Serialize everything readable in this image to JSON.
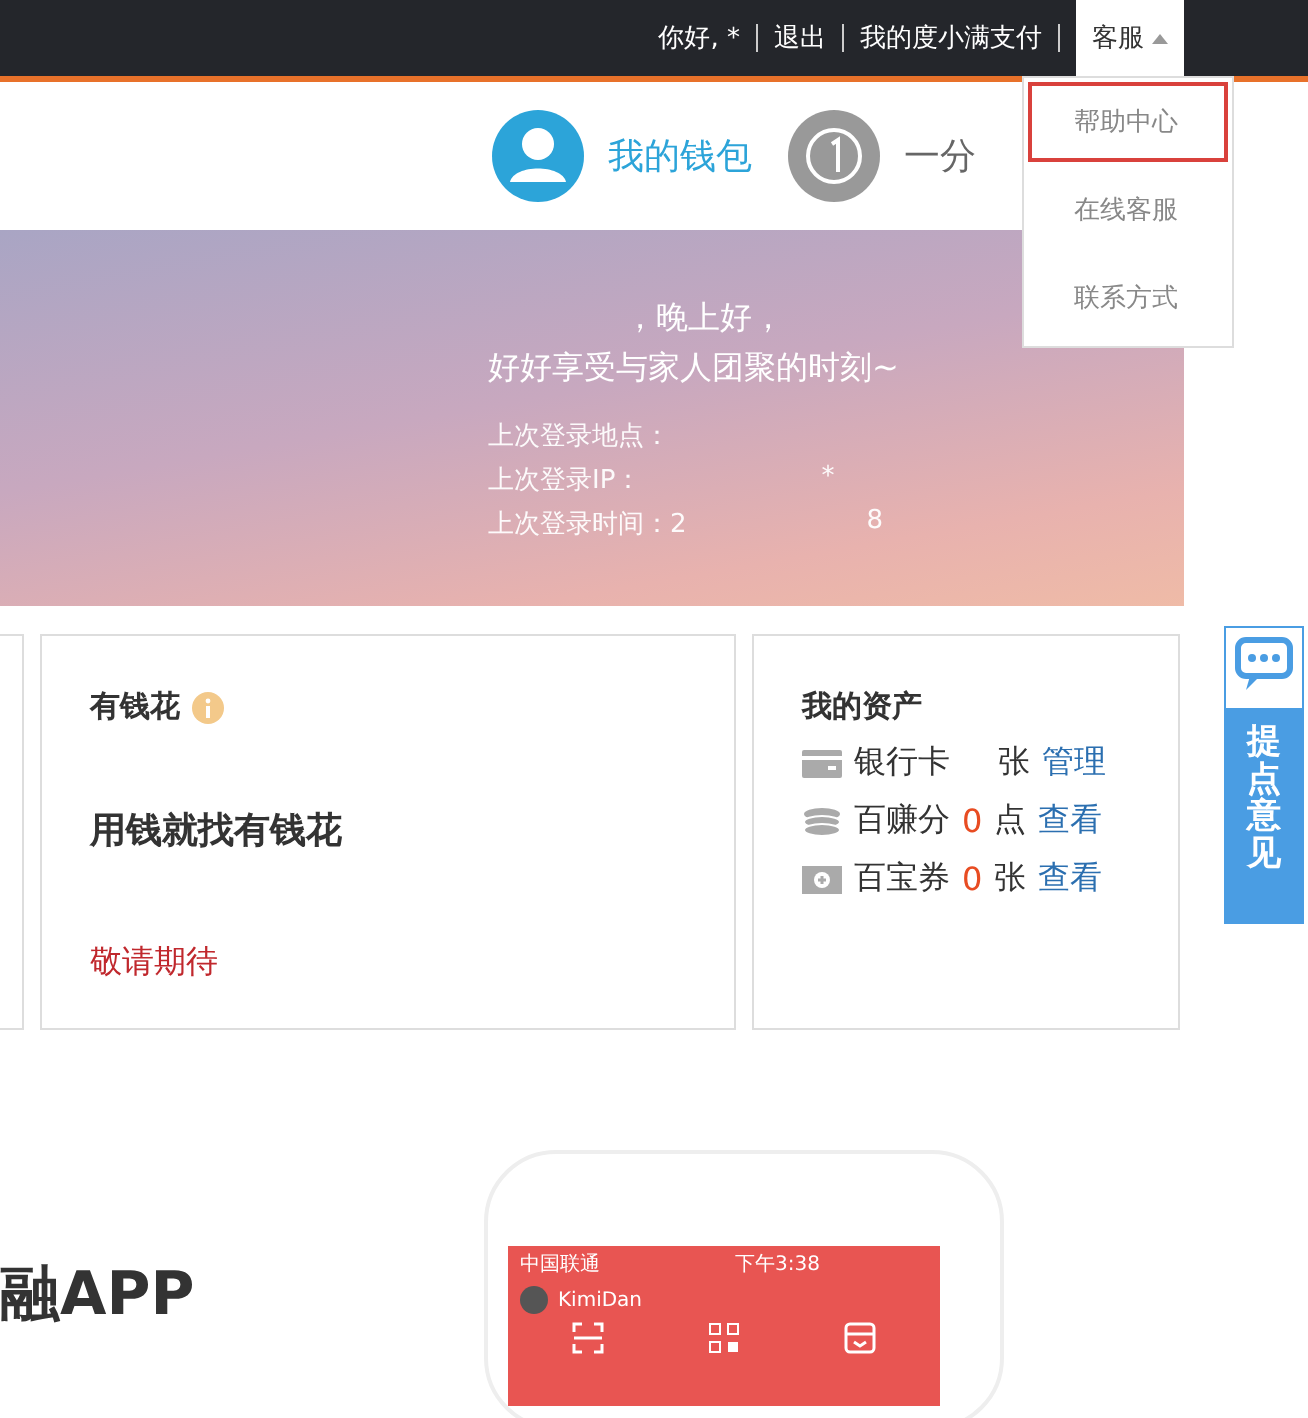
{
  "top_bar": {
    "greeting": "你好, *",
    "links": [
      {
        "label": "退出"
      },
      {
        "label": "我的度小满支付"
      }
    ],
    "support_menu": {
      "label": "客服",
      "expanded": true,
      "items": [
        {
          "label": "帮助中心",
          "selected": true
        },
        {
          "label": "在线客服",
          "selected": false
        },
        {
          "label": "联系方式",
          "selected": false
        }
      ]
    }
  },
  "nav": [
    {
      "label": "我的钱包",
      "kind": "user",
      "selected": true
    },
    {
      "label": "一分",
      "kind": "one",
      "selected": false
    }
  ],
  "banner": {
    "greeting": "，晚上好，",
    "message": "好好享受与家人团聚的时刻~",
    "login_info": [
      {
        "label": "上次登录地点："
      },
      {
        "label": "上次登录IP：",
        "tail": "*"
      },
      {
        "label": "上次登录时间：2",
        "tail": "8"
      }
    ]
  },
  "credit_card": {
    "title": "有钱花",
    "slogan": "用钱就找有钱花",
    "status": "敬请期待"
  },
  "assets": {
    "title": "我的资产",
    "items": [
      {
        "kind": "card",
        "label": "银行卡",
        "unit": "张",
        "action": "管理"
      },
      {
        "kind": "coins",
        "label": "百赚分",
        "count": "0",
        "unit": "点",
        "action": "查看"
      },
      {
        "kind": "ticket",
        "label": "百宝券",
        "count": "0",
        "unit": "张",
        "action": "查看"
      }
    ]
  },
  "feedback": {
    "label": "提点意见"
  },
  "app_section": {
    "title": "融APP",
    "phone": {
      "carrier": "中国联通",
      "time": "下午3:38",
      "user": "KimiDan"
    }
  }
}
